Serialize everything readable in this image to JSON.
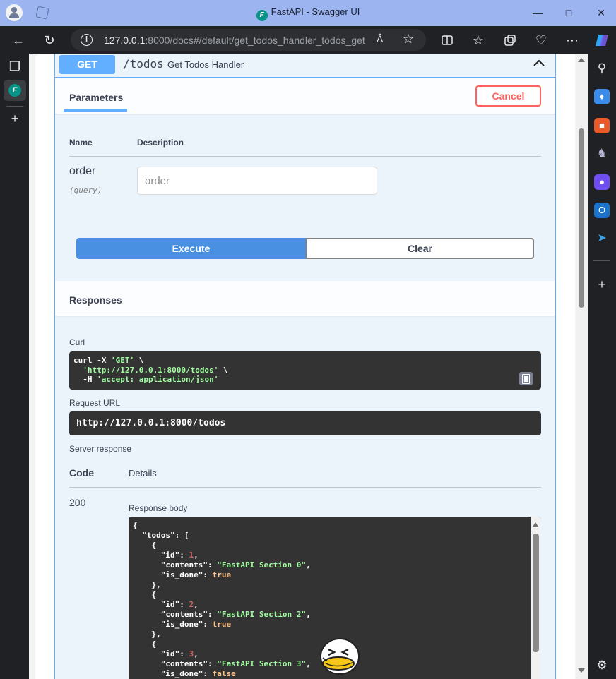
{
  "browser": {
    "window_title": "FastAPI - Swagger UI",
    "url_host": "127.0.0.1",
    "url_rest": ":8000/docs#/default/get_todos_handler_todos_get",
    "reader_label": "Â",
    "icons": [
      "back-icon",
      "refresh-icon",
      "info-icon",
      "star-icon",
      "split-screen-icon",
      "favorites-icon",
      "collections-icon",
      "heart-icon",
      "more-icon",
      "copilot-icon"
    ]
  },
  "operation": {
    "method": "GET",
    "path": "/todos",
    "summary": "Get Todos Handler",
    "accent_color": "#61affe"
  },
  "parameters": {
    "tab_label": "Parameters",
    "cancel_label": "Cancel",
    "col_name": "Name",
    "col_description": "Description",
    "items": [
      {
        "name": "order",
        "in": "(query)",
        "placeholder": "order",
        "value": ""
      }
    ]
  },
  "actions": {
    "execute_label": "Execute",
    "clear_label": "Clear"
  },
  "responses": {
    "title": "Responses",
    "curl_label": "Curl",
    "curl_lines": [
      {
        "pre": "curl -X ",
        "str": "'GET'",
        "post": " \\"
      },
      {
        "pre": "  ",
        "str": "'http://127.0.0.1:8000/todos'",
        "post": " \\"
      },
      {
        "pre": "  -H ",
        "str": "'accept: application/json'",
        "post": ""
      }
    ],
    "request_url_label": "Request URL",
    "request_url": "http://127.0.0.1:8000/todos",
    "server_response_label": "Server response",
    "col_code": "Code",
    "col_details": "Details",
    "code": "200",
    "response_body_label": "Response body",
    "todos": [
      {
        "id": 1,
        "contents": "FastAPI Section 0",
        "is_done": "true"
      },
      {
        "id": 2,
        "contents": "FastAPI Section 2",
        "is_done": "true"
      },
      {
        "id": 3,
        "contents": "FastAPI Section 3",
        "is_done": "false"
      }
    ]
  }
}
